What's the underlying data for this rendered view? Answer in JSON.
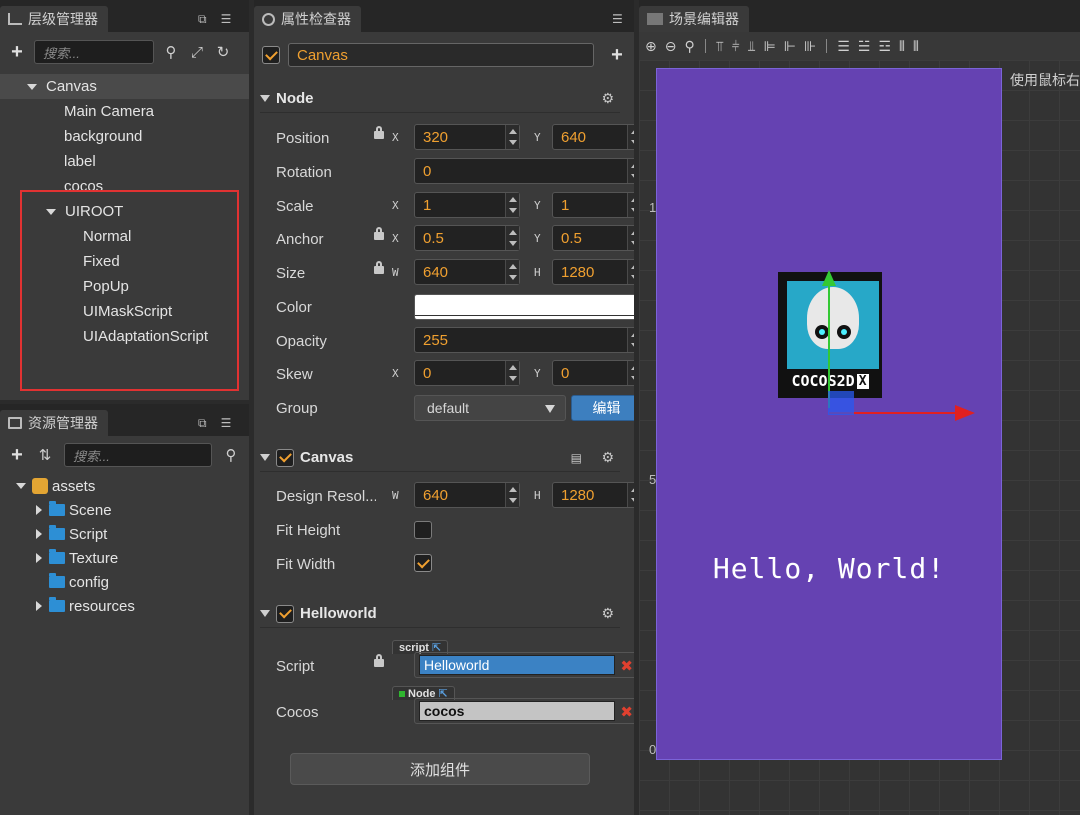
{
  "hierarchy": {
    "tab": "层级管理器",
    "search_placeholder": "搜索...",
    "nodes": [
      "Canvas",
      "Main Camera",
      "background",
      "label",
      "cocos",
      "UIROOT",
      "Normal",
      "Fixed",
      "PopUp",
      "UIMaskScript",
      "UIAdaptationScript"
    ]
  },
  "assets": {
    "tab": "资源管理器",
    "search_placeholder": "搜索...",
    "items": [
      "assets",
      "Scene",
      "Script",
      "Texture",
      "config",
      "resources"
    ]
  },
  "inspector": {
    "tab": "属性检查器",
    "node_name": "Canvas",
    "node_section": "Node",
    "props": {
      "position": {
        "label": "Position",
        "x": "320",
        "y": "640"
      },
      "rotation": {
        "label": "Rotation",
        "value": "0"
      },
      "scale": {
        "label": "Scale",
        "x": "1",
        "y": "1"
      },
      "anchor": {
        "label": "Anchor",
        "x": "0.5",
        "y": "0.5"
      },
      "size": {
        "label": "Size",
        "w": "640",
        "h": "1280"
      },
      "color": {
        "label": "Color",
        "value": "#FFFFFF"
      },
      "opacity": {
        "label": "Opacity",
        "value": "255"
      },
      "skew": {
        "label": "Skew",
        "x": "0",
        "y": "0"
      },
      "group": {
        "label": "Group",
        "value": "default",
        "edit_button": "编辑"
      }
    },
    "axis": {
      "x": "X",
      "y": "Y",
      "w": "W",
      "h": "H"
    },
    "canvas_section": "Canvas",
    "canvas": {
      "design_label": "Design Resol...",
      "w": "640",
      "h": "1280",
      "fit_height_label": "Fit Height",
      "fit_height": false,
      "fit_width_label": "Fit Width",
      "fit_width": true
    },
    "helloworld_section": "Helloworld",
    "helloworld": {
      "script_label": "Script",
      "script_tag": "script",
      "script_value": "Helloworld",
      "cocos_label": "Cocos",
      "cocos_tag": "Node",
      "cocos_value": "cocos"
    },
    "add_component": "添加组件"
  },
  "scene": {
    "tab": "场景编辑器",
    "hint": "使用鼠标右",
    "ruler": [
      "1",
      "5",
      "0"
    ],
    "hello_text": "Hello, World!",
    "logo_text": "COCOS2D",
    "logo_x": "X",
    "design_color": "#6542b2"
  }
}
